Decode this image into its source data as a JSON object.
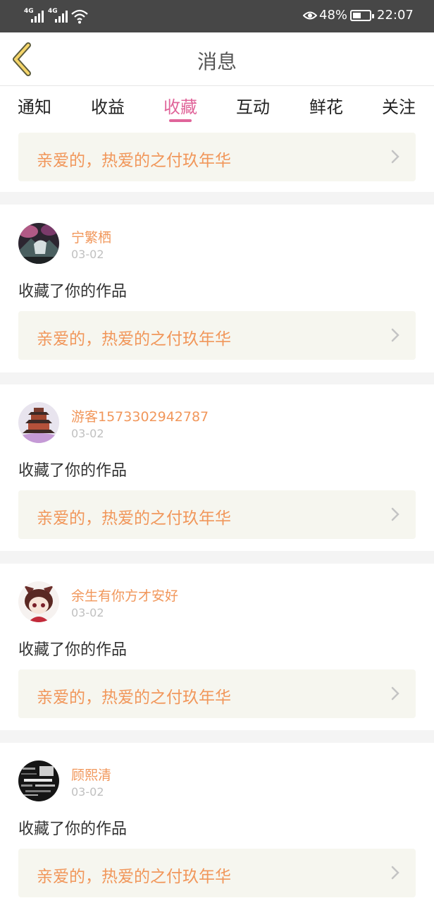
{
  "status_bar": {
    "network_1": "4G",
    "network_2": "4G",
    "battery_percent": "48%",
    "time": "22:07"
  },
  "header": {
    "title": "消息"
  },
  "tabs": [
    {
      "label": "通知",
      "active": false
    },
    {
      "label": "收益",
      "active": false
    },
    {
      "label": "收藏",
      "active": true
    },
    {
      "label": "互动",
      "active": false
    },
    {
      "label": "鲜花",
      "active": false
    },
    {
      "label": "关注",
      "active": false
    }
  ],
  "colors": {
    "accent": "#e0659a",
    "orange_text": "#f1975b",
    "link_bg": "#f6f6ef",
    "status_bar_bg": "#474747"
  },
  "top_partial_card": {
    "work_title": "亲爱的，热爱的之付玖年华"
  },
  "notifications": [
    {
      "username": "宁繁栖",
      "date": "03-02",
      "action": "收藏了你的作品",
      "work_title": "亲爱的，热爱的之付玖年华",
      "avatar": "landscape-avatar"
    },
    {
      "username": "游客1573302942787",
      "date": "03-02",
      "action": "收藏了你的作品",
      "work_title": "亲爱的，热爱的之付玖年华",
      "avatar": "pagoda-avatar"
    },
    {
      "username": "余生有你方才安好",
      "date": "03-02",
      "action": "收藏了你的作品",
      "work_title": "亲爱的，热爱的之付玖年华",
      "avatar": "anime-avatar"
    },
    {
      "username": "顾熙清",
      "date": "03-02",
      "action": "收藏了你的作品",
      "work_title": "亲爱的，热爱的之付玖年华",
      "avatar": "text-collage-avatar"
    }
  ]
}
